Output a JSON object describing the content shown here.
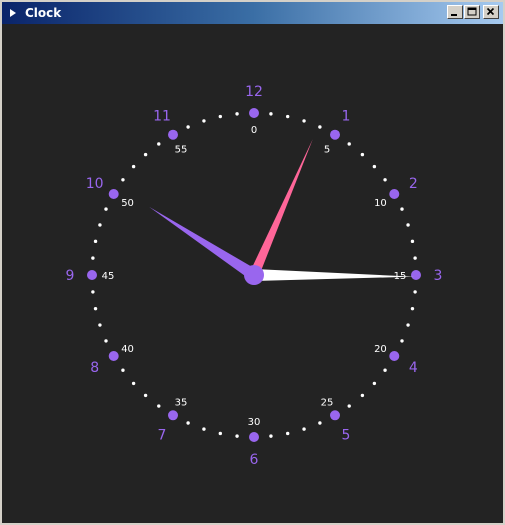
{
  "window": {
    "title": "Clock"
  },
  "clock": {
    "hour_numbers": [
      "12",
      "1",
      "2",
      "3",
      "4",
      "5",
      "6",
      "7",
      "8",
      "9",
      "10",
      "11"
    ],
    "minute_labels": [
      "0",
      "5",
      "10",
      "15",
      "20",
      "25",
      "30",
      "35",
      "40",
      "45",
      "50",
      "55"
    ],
    "time": {
      "hour_hand_minutes": 50.5,
      "minute_hand": 15.1,
      "second_hand": 3.9
    },
    "colors": {
      "background": "#232323",
      "hour_marker": "#9966ee",
      "minute_dot": "#ffffff",
      "hour_hand": "#9966ee",
      "minute_hand": "#ffffff",
      "second_hand": "#ff6699",
      "center": "#9966ee"
    }
  }
}
